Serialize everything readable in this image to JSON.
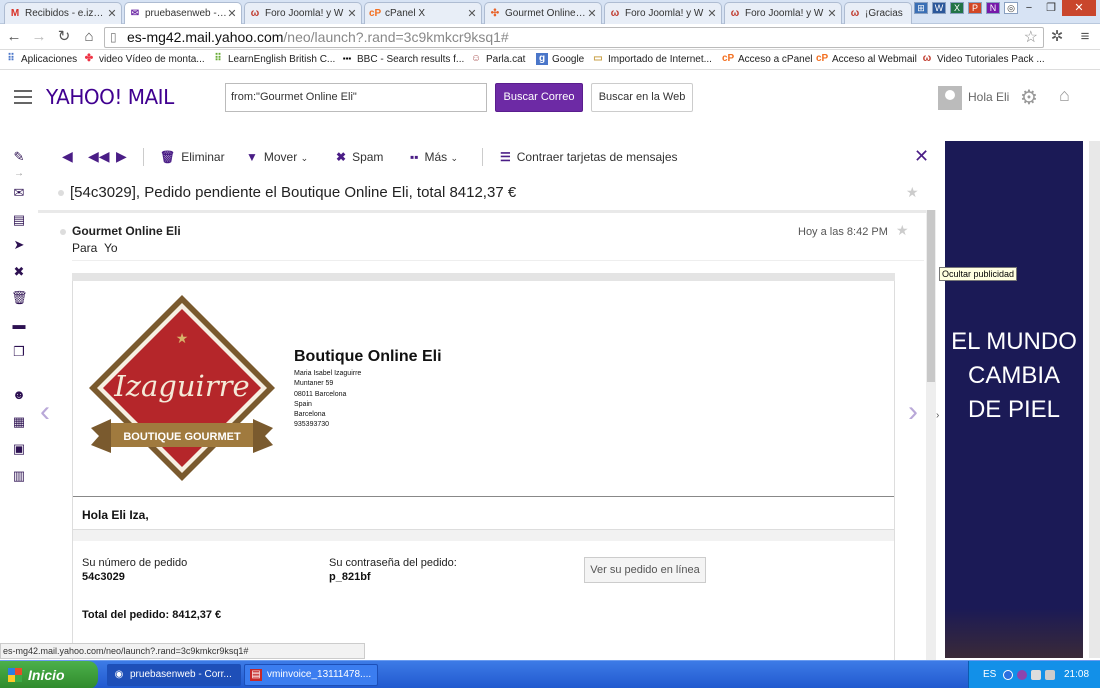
{
  "browser": {
    "tabs": [
      {
        "title": "Recibidos - e.izagu",
        "icon": "gmail-icon"
      },
      {
        "title": "pruebasenweb - Co",
        "icon": "yahoo-mail-icon",
        "active": true
      },
      {
        "title": "Foro Joomla! y W",
        "icon": "joomla-forum-icon"
      },
      {
        "title": "cPanel X",
        "icon": "cpanel-icon"
      },
      {
        "title": "Gourmet Online Eli",
        "icon": "joomla-icon"
      },
      {
        "title": "Foro Joomla! y W",
        "icon": "joomla-forum-icon"
      },
      {
        "title": "Foro Joomla! y W",
        "icon": "joomla-forum-icon"
      },
      {
        "title": "¡Gracias",
        "icon": "joomla-forum-icon"
      }
    ],
    "url_host": "es-mg42.mail.yahoo.com",
    "url_path": "/neo/launch?.rand=3c9kmkcr9ksq1#",
    "bookmarks": [
      {
        "label": "Aplicaciones",
        "icon": "apps-icon"
      },
      {
        "label": "video Vídeo de monta...",
        "icon": "colored-squares-icon"
      },
      {
        "label": "LearnEnglish  British C...",
        "icon": "green-squares-icon"
      },
      {
        "label": "BBC - Search results f...",
        "icon": "bbc-icon"
      },
      {
        "label": "Parla.cat",
        "icon": "parla-icon"
      },
      {
        "label": "Google",
        "icon": "google-icon"
      },
      {
        "label": "Importado de Internet...",
        "icon": "folder-icon"
      },
      {
        "label": "Acceso a cPanel",
        "icon": "cpanel-icon"
      },
      {
        "label": "Acceso al Webmail",
        "icon": "cpanel-icon"
      },
      {
        "label": "Video Tutoriales Pack ...",
        "icon": "joomla-forum-icon"
      }
    ],
    "status_url": "es-mg42.mail.yahoo.com/neo/launch?.rand=3c9kmkcr9ksq1#"
  },
  "yahoo": {
    "logo": "YAHOO! MAIL",
    "search_value": "from:\"Gourmet Online Eli\"",
    "search_mail_btn": "Buscar Correo",
    "search_web_btn": "Buscar en la Web",
    "user_greeting": "Hola Eli"
  },
  "toolbar": {
    "delete": "Eliminar",
    "move": "Mover",
    "spam": "Spam",
    "more": "Más",
    "collapse": "Contraer tarjetas de mensajes"
  },
  "message": {
    "subject": "[54c3029], Pedido pendiente el Boutique Online Eli, total 8412,37 €",
    "from": "Gourmet Online Eli",
    "to_label": "Para",
    "to_value": "Yo",
    "time": "Hoy a las 8:42 PM"
  },
  "email": {
    "logo_main": "Izaguirre",
    "logo_banner": "BOUTIQUE GOURMET",
    "shop_name": "Boutique Online Eli",
    "address_lines": [
      "Maria Isabel Izaguirre",
      "Muntaner 59",
      "08011 Barcelona",
      "Spain",
      "Barcelona",
      "935393730"
    ],
    "greeting": "Hola Eli Iza,",
    "order_number_label": "Su número de pedido",
    "order_number": "54c3029",
    "password_label": "Su contraseña del pedido:",
    "password": "p_821bf",
    "view_order_btn": "Ver su pedido en línea",
    "total": "Total del pedido: 8412,37 €"
  },
  "ad": {
    "hide_tooltip": "Ocultar publicidad",
    "line1": "EL MUNDO",
    "line2": "CAMBIA",
    "line3": "DE PIEL"
  },
  "taskbar": {
    "start": "Inicio",
    "tasks": [
      {
        "label": "pruebasenweb - Corr...",
        "icon": "chrome-icon"
      },
      {
        "label": "vminvoice_13111478....",
        "icon": "pdf-icon"
      }
    ],
    "lang": "ES",
    "clock": "21:08"
  },
  "colors": {
    "yahoo_purple": "#400090",
    "button_purple": "#6d2aa5",
    "logo_red": "#b5262a",
    "logo_brown": "#7a5a2e",
    "ad_bg": "#1b1a56"
  }
}
